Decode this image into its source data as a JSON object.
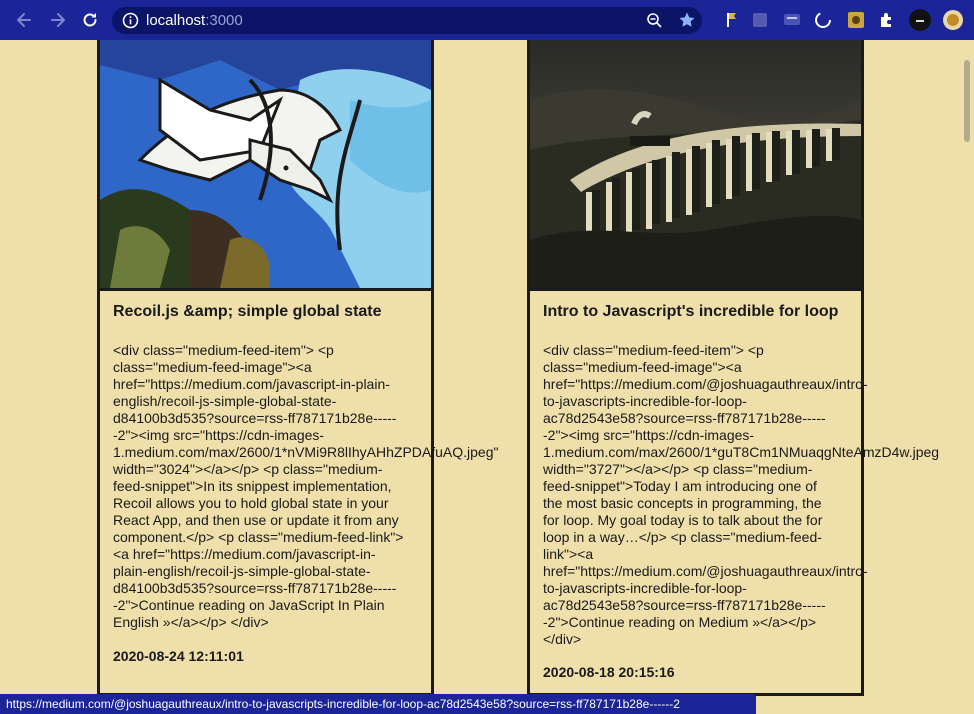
{
  "browser": {
    "url_host": "localhost",
    "url_port": ":3000"
  },
  "cards": [
    {
      "title": "Recoil.js &amp; simple global state",
      "body": "<div class=\"medium-feed-item\"> <p\nclass=\"medium-feed-image\"><a\nhref=\"https://medium.com/javascript-in-plain-\nenglish/recoil-js-simple-global-state-\nd84100b3d535?source=rss-ff787171b28e-----\n-2\"><img src=\"https://cdn-images-\n1.medium.com/max/2600/1*nVMi9R8lIhyAHhZPDAfuAQ.jpeg\"\nwidth=\"3024\"></a></p> <p class=\"medium-\nfeed-snippet\">In its snippest implementation,\nRecoil allows you to hold global state in your\nReact App, and then use or update it from any\ncomponent.</p> <p class=\"medium-feed-link\">\n<a href=\"https://medium.com/javascript-in-\nplain-english/recoil-js-simple-global-state-\nd84100b3d535?source=rss-ff787171b28e-----\n-2\">Continue reading on JavaScript In Plain\nEnglish »</a></p> </div>",
      "date": "2020-08-24 12:11:01"
    },
    {
      "title": "Intro to Javascript's incredible for loop",
      "body": "<div class=\"medium-feed-item\"> <p\nclass=\"medium-feed-image\"><a\nhref=\"https://medium.com/@joshuagauthreaux/intro-\nto-javascripts-incredible-for-loop-\nac78d2543e58?source=rss-ff787171b28e-----\n-2\"><img src=\"https://cdn-images-\n1.medium.com/max/2600/1*guT8Cm1NMuaqgNteAmzD4w.jpeg\nwidth=\"3727\"></a></p> <p class=\"medium-\nfeed-snippet\">Today I am introducing one of\nthe most basic concepts in programming, the\nfor loop. My goal today is to talk about the for\nloop in a way…</p> <p class=\"medium-feed-\nlink\"><a\nhref=\"https://medium.com/@joshuagauthreaux/intro-\nto-javascripts-incredible-for-loop-\nac78d2543e58?source=rss-ff787171b28e-----\n-2\">Continue reading on Medium »</a></p>\n</div>",
      "date": "2020-08-18 20:15:16"
    }
  ],
  "status_bar": {
    "url": "https://medium.com/@joshuagauthreaux/intro-to-javascripts-incredible-for-loop-ac78d2543e58?source=rss-ff787171b28e------2"
  },
  "icons": {
    "back": "back-arrow-icon",
    "forward": "forward-arrow-icon",
    "reload": "reload-icon",
    "info": "info-icon",
    "zoom": "zoom-icon",
    "bookmark": "star-icon",
    "extensions": "puzzle-icon"
  },
  "colors": {
    "page_background": "#efdfaa",
    "chrome": "#1b2597",
    "omnibox": "#0b1467",
    "border": "#1a1a1a"
  }
}
